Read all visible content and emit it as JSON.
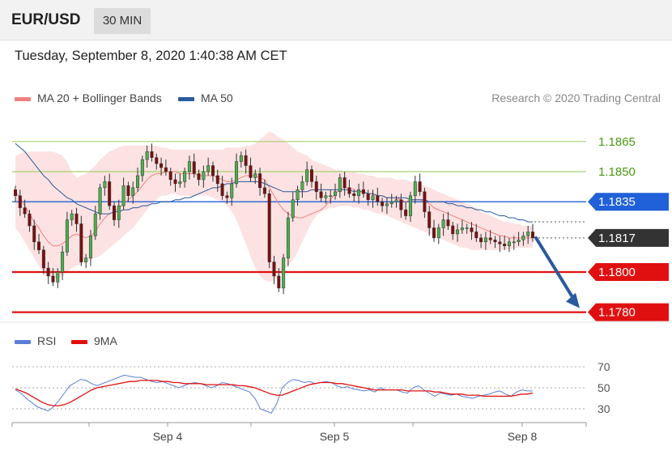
{
  "header": {
    "pair": "EUR/USD",
    "timeframe": "30 MIN"
  },
  "datetime": "Tuesday, September 8, 2020 1:40:38 AM CET",
  "legend": {
    "ma20_label": "MA 20 + Bollinger Bands",
    "ma20_color": "#f08080",
    "ma50_label": "MA 50",
    "ma50_color": "#2a5a9e"
  },
  "copyright": "Research © 2020 Trading Central",
  "rsi_legend": {
    "rsi_label": "RSI",
    "rsi_color": "#5b7fd6",
    "ma9_label": "9MA",
    "ma9_color": "#e01010"
  },
  "chart_data": {
    "type": "candlestick",
    "ylim": [
      1.1775,
      1.1875
    ],
    "x_ticks": [
      "Sep 4",
      "Sep 5",
      "Sep 8"
    ],
    "levels": [
      {
        "value": 1.1865,
        "label": "1.1865",
        "kind": "resistance-minor",
        "color": "#a8d070",
        "text_color": "#4a9a10"
      },
      {
        "value": 1.185,
        "label": "1.1850",
        "kind": "resistance-minor",
        "color": "#a8d070",
        "text_color": "#4a9a10"
      },
      {
        "value": 1.1835,
        "label": "1.1835",
        "kind": "pivot",
        "color": "#2060d8",
        "text_color": "#ffffff"
      },
      {
        "value": 1.1817,
        "label": "1.1817",
        "kind": "last-price",
        "color": "#333333",
        "text_color": "#ffffff"
      },
      {
        "value": 1.18,
        "label": "1.1800",
        "kind": "support",
        "color": "#e01010",
        "text_color": "#ffffff"
      },
      {
        "value": 1.178,
        "label": "1.1780",
        "kind": "support",
        "color": "#e01010",
        "text_color": "#ffffff"
      }
    ],
    "forecast_arrow": {
      "from": 1.1817,
      "to": 1.1782,
      "color": "#2a5a9e"
    },
    "close": [
      1.1838,
      1.1832,
      1.1829,
      1.1823,
      1.1815,
      1.1811,
      1.1802,
      1.1798,
      1.1795,
      1.18,
      1.181,
      1.1826,
      1.1829,
      1.1824,
      1.1805,
      1.1807,
      1.1818,
      1.1829,
      1.1842,
      1.1845,
      1.1833,
      1.1826,
      1.1833,
      1.1843,
      1.1838,
      1.1842,
      1.1848,
      1.1856,
      1.186,
      1.1857,
      1.1854,
      1.1852,
      1.185,
      1.1846,
      1.1844,
      1.1845,
      1.185,
      1.1855,
      1.1849,
      1.1846,
      1.185,
      1.1853,
      1.1848,
      1.1844,
      1.1838,
      1.1837,
      1.1844,
      1.1855,
      1.1858,
      1.1853,
      1.1847,
      1.1849,
      1.1842,
      1.1839,
      1.1805,
      1.1798,
      1.1792,
      1.1807,
      1.1827,
      1.1836,
      1.1841,
      1.1845,
      1.1851,
      1.1845,
      1.184,
      1.1837,
      1.1838,
      1.1838,
      1.184,
      1.1847,
      1.1842,
      1.1839,
      1.1838,
      1.1841,
      1.1839,
      1.1836,
      1.1838,
      1.1835,
      1.1833,
      1.1834,
      1.1835,
      1.1836,
      1.1831,
      1.1828,
      1.1838,
      1.1845,
      1.184,
      1.183,
      1.1822,
      1.1817,
      1.1822,
      1.1826,
      1.1823,
      1.1819,
      1.1821,
      1.1822,
      1.1822,
      1.182,
      1.1817,
      1.1815,
      1.1817,
      1.1816,
      1.1815,
      1.1814,
      1.1813,
      1.1815,
      1.1815,
      1.1816,
      1.1818,
      1.182,
      1.1817
    ],
    "ma20": [
      1.184,
      1.1837,
      1.1833,
      1.1829,
      1.1825,
      1.1822,
      1.1818,
      1.1815,
      1.1813,
      1.1813,
      1.1814,
      1.1816,
      1.1818,
      1.1819,
      1.1818,
      1.1817,
      1.1818,
      1.182,
      1.1824,
      1.1827,
      1.1829,
      1.183,
      1.1832,
      1.1834,
      1.1836,
      1.1838,
      1.184,
      1.1843,
      1.1846,
      1.1848,
      1.1849,
      1.1849,
      1.185,
      1.185,
      1.185,
      1.1849,
      1.1849,
      1.1849,
      1.1849,
      1.1848,
      1.1848,
      1.1848,
      1.1848,
      1.1847,
      1.1846,
      1.1845,
      1.1845,
      1.1846,
      1.1847,
      1.1848,
      1.1848,
      1.1848,
      1.1847,
      1.1846,
      1.1842,
      1.1838,
      1.1834,
      1.1831,
      1.1829,
      1.1828,
      1.1827,
      1.1827,
      1.1828,
      1.1829,
      1.183,
      1.1831,
      1.1833,
      1.1836,
      1.1839,
      1.1841,
      1.1842,
      1.1842,
      1.1841,
      1.184,
      1.184,
      1.1839,
      1.1839,
      1.1838,
      1.1838,
      1.1837,
      1.1837,
      1.1837,
      1.1836,
      1.1835,
      1.1836,
      1.1836,
      1.1836,
      1.1835,
      1.1834,
      1.1832,
      1.1831,
      1.183,
      1.1829,
      1.1828,
      1.1827,
      1.1826,
      1.1825,
      1.1824,
      1.1823,
      1.1822,
      1.1821,
      1.182,
      1.1819,
      1.1818,
      1.1818,
      1.1817,
      1.1817,
      1.1817,
      1.1817,
      1.1817,
      1.1817
    ],
    "ma50": [
      1.1864,
      1.1862,
      1.186,
      1.1857,
      1.1854,
      1.1851,
      1.1848,
      1.1846,
      1.1843,
      1.1841,
      1.1839,
      1.1837,
      1.1836,
      1.1834,
      1.1833,
      1.1832,
      1.1831,
      1.183,
      1.1829,
      1.1829,
      1.1829,
      1.183,
      1.183,
      1.1831,
      1.1831,
      1.1832,
      1.1832,
      1.1833,
      1.1833,
      1.1834,
      1.1834,
      1.1835,
      1.1835,
      1.1835,
      1.1836,
      1.1836,
      1.1837,
      1.1837,
      1.1838,
      1.1839,
      1.184,
      1.1841,
      1.1842,
      1.1842,
      1.1843,
      1.1844,
      1.1844,
      1.1845,
      1.1845,
      1.1845,
      1.1845,
      1.1845,
      1.1845,
      1.1844,
      1.1843,
      1.1842,
      1.1841,
      1.184,
      1.184,
      1.184,
      1.184,
      1.184,
      1.184,
      1.1841,
      1.1841,
      1.1841,
      1.1841,
      1.1841,
      1.1841,
      1.1841,
      1.1841,
      1.1841,
      1.184,
      1.184,
      1.184,
      1.1839,
      1.1839,
      1.1838,
      1.1838,
      1.1837,
      1.1837,
      1.1837,
      1.1837,
      1.1837,
      1.1836,
      1.1836,
      1.1836,
      1.1836,
      1.1835,
      1.1835,
      1.1835,
      1.1835,
      1.1834,
      1.1834,
      1.1833,
      1.1833,
      1.1832,
      1.1832,
      1.1831,
      1.1831,
      1.183,
      1.183,
      1.1829,
      1.1828,
      1.1828,
      1.1827,
      1.1827,
      1.1826,
      1.1826,
      1.1825,
      1.1825
    ],
    "bb_upper": [
      1.1858,
      1.1859,
      1.186,
      1.186,
      1.186,
      1.186,
      1.186,
      1.186,
      1.186,
      1.1859,
      1.1858,
      1.1855,
      1.185,
      1.1847,
      1.1848,
      1.1849,
      1.1851,
      1.1853,
      1.1856,
      1.1858,
      1.186,
      1.1861,
      1.1862,
      1.1863,
      1.1863,
      1.1863,
      1.1863,
      1.1863,
      1.1863,
      1.1863,
      1.1863,
      1.1862,
      1.1862,
      1.1861,
      1.1861,
      1.1861,
      1.1861,
      1.1861,
      1.1861,
      1.1861,
      1.1861,
      1.1861,
      1.1861,
      1.1861,
      1.1861,
      1.1862,
      1.1862,
      1.1862,
      1.1862,
      1.1863,
      1.1863,
      1.1864,
      1.1866,
      1.1868,
      1.187,
      1.1869,
      1.1867,
      1.1866,
      1.1864,
      1.1862,
      1.186,
      1.1859,
      1.1858,
      1.1856,
      1.1855,
      1.1854,
      1.1853,
      1.1852,
      1.1851,
      1.1851,
      1.185,
      1.185,
      1.185,
      1.1849,
      1.1849,
      1.1848,
      1.1848,
      1.1847,
      1.1847,
      1.1847,
      1.1847,
      1.1846,
      1.1846,
      1.1846,
      1.1845,
      1.1844,
      1.1844,
      1.1843,
      1.1842,
      1.1841,
      1.184,
      1.1839,
      1.1838,
      1.1837,
      1.1836,
      1.1835,
      1.1834,
      1.1833,
      1.1832,
      1.183,
      1.1829,
      1.1828,
      1.1827,
      1.1826,
      1.1825,
      1.1825,
      1.1824,
      1.1824,
      1.1823,
      1.1823,
      1.1823
    ],
    "bb_lower": [
      1.1822,
      1.1819,
      1.1815,
      1.1811,
      1.1807,
      1.1803,
      1.18,
      1.1798,
      1.1797,
      1.1797,
      1.1798,
      1.18,
      1.1802,
      1.1803,
      1.1804,
      1.1805,
      1.1806,
      1.1807,
      1.1808,
      1.181,
      1.1812,
      1.1814,
      1.1816,
      1.1818,
      1.182,
      1.1822,
      1.1825,
      1.1828,
      1.1831,
      1.1834,
      1.1836,
      1.1838,
      1.1838,
      1.1839,
      1.1839,
      1.1838,
      1.1838,
      1.1838,
      1.1838,
      1.1838,
      1.1838,
      1.1838,
      1.1837,
      1.1836,
      1.1835,
      1.1833,
      1.183,
      1.1826,
      1.182,
      1.1814,
      1.1808,
      1.1802,
      1.1798,
      1.1796,
      1.1795,
      1.1796,
      1.1798,
      1.18,
      1.1803,
      1.1806,
      1.181,
      1.1815,
      1.182,
      1.1825,
      1.1828,
      1.183,
      1.1831,
      1.1832,
      1.1832,
      1.1833,
      1.1833,
      1.1833,
      1.1832,
      1.1832,
      1.1831,
      1.1831,
      1.183,
      1.1829,
      1.1829,
      1.1828,
      1.1827,
      1.1826,
      1.1825,
      1.1824,
      1.1823,
      1.1822,
      1.1821,
      1.182,
      1.1819,
      1.1818,
      1.1817,
      1.1816,
      1.1815,
      1.1814,
      1.1813,
      1.1812,
      1.1812,
      1.1811,
      1.1811,
      1.1811,
      1.1811,
      1.1811,
      1.1811,
      1.1811,
      1.1811,
      1.1811,
      1.1812,
      1.1812,
      1.1812,
      1.1812,
      1.1812
    ],
    "rsi": {
      "ylim": [
        20,
        80
      ],
      "ticks": [
        70,
        50,
        30
      ],
      "rsi": [
        48,
        45,
        40,
        36,
        32,
        30,
        28,
        32,
        38,
        45,
        52,
        55,
        58,
        57,
        54,
        52,
        54,
        56,
        58,
        60,
        62,
        61,
        60,
        60,
        58,
        56,
        55,
        56,
        54,
        52,
        50,
        52,
        54,
        55,
        54,
        52,
        50,
        52,
        55,
        54,
        52,
        50,
        48,
        46,
        40,
        30,
        28,
        26,
        35,
        50,
        55,
        58,
        57,
        55,
        56,
        54,
        55,
        56,
        55,
        52,
        50,
        51,
        49,
        48,
        47,
        48,
        46,
        50,
        48,
        48,
        48,
        46,
        45,
        50,
        52,
        48,
        45,
        42,
        45,
        44,
        43,
        44,
        42,
        41,
        40,
        42,
        43,
        44,
        46,
        47,
        44,
        42,
        46,
        48,
        47,
        47
      ],
      "ma9": [
        49,
        47,
        45,
        42,
        39,
        36,
        34,
        33,
        33,
        34,
        36,
        39,
        42,
        45,
        48,
        50,
        51,
        52,
        53,
        54,
        55,
        56,
        56,
        57,
        57,
        57,
        57,
        56,
        56,
        55,
        55,
        54,
        54,
        54,
        54,
        53,
        53,
        53,
        53,
        53,
        53,
        52,
        52,
        51,
        50,
        48,
        46,
        44,
        43,
        43,
        45,
        47,
        49,
        51,
        53,
        54,
        55,
        55,
        55,
        54,
        54,
        53,
        52,
        51,
        50,
        49,
        48,
        48,
        48,
        48,
        48,
        48,
        47,
        47,
        47,
        47,
        47,
        46,
        46,
        45,
        44,
        44,
        44,
        43,
        43,
        43,
        42,
        42,
        42,
        42,
        42,
        42,
        43,
        44,
        44,
        45
      ]
    }
  }
}
